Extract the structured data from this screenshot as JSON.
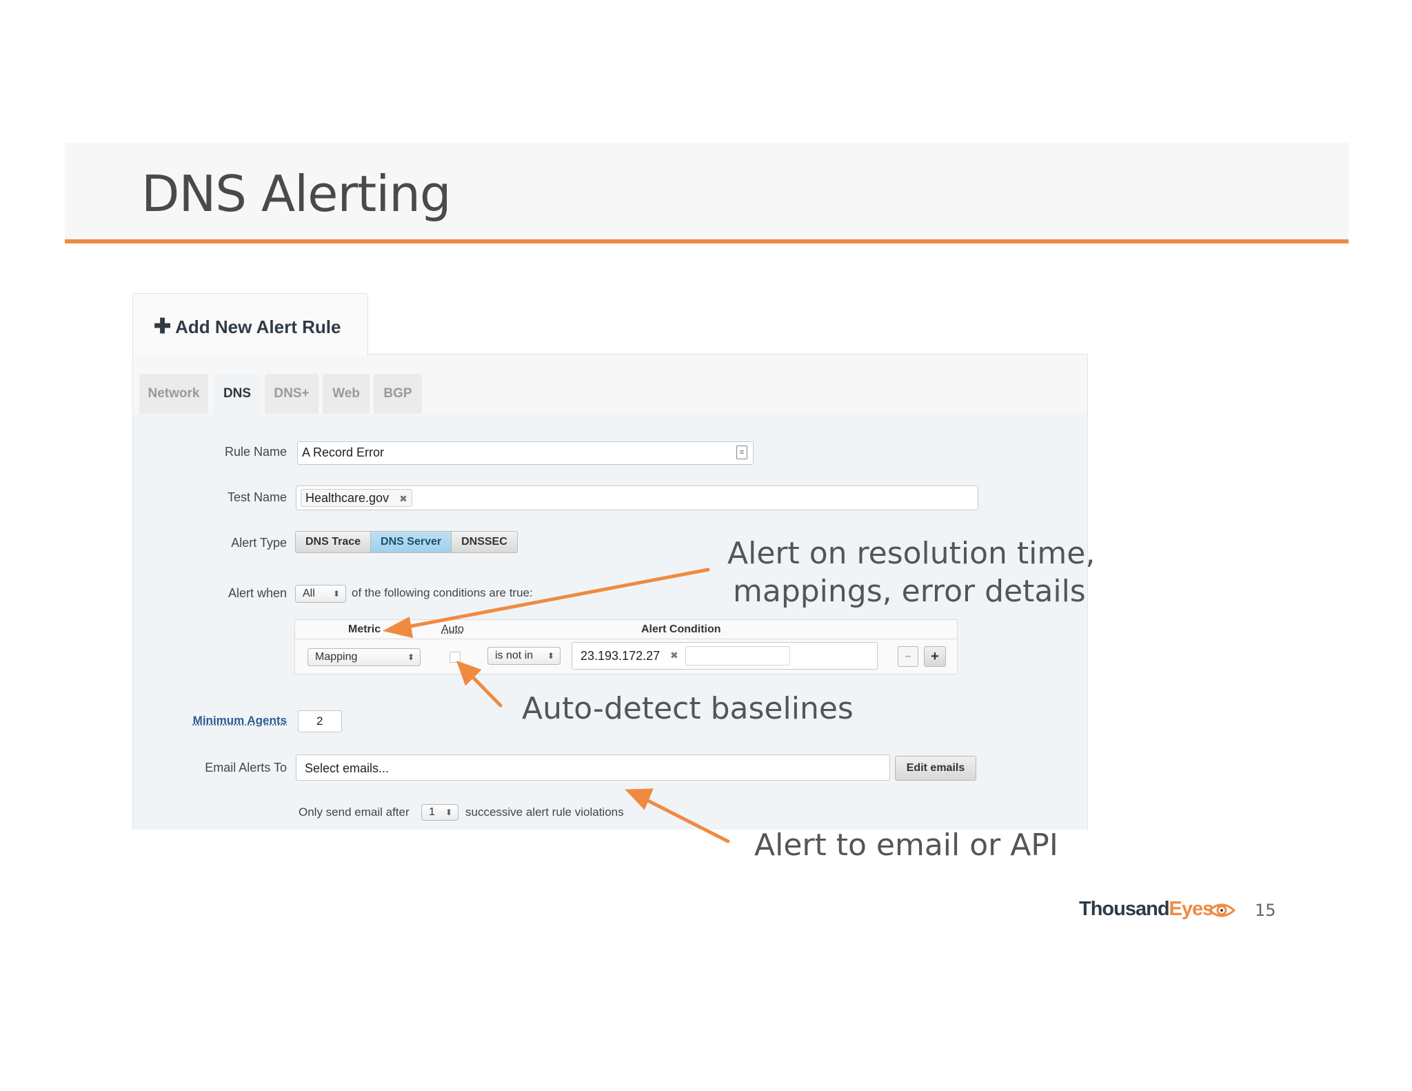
{
  "slide": {
    "title": "DNS Alerting",
    "page_number": "15"
  },
  "logo": {
    "part1": "Thousand",
    "part2": "Eyes"
  },
  "colors": {
    "accent": "#f08a40",
    "logo_dark": "#2f3b47",
    "active_tab_blue": "#9fd0ea"
  },
  "panel": {
    "header_tab": {
      "icon": "plus-icon",
      "label": "Add New Alert Rule"
    },
    "tabs": [
      {
        "label": "Network",
        "active": false
      },
      {
        "label": "DNS",
        "active": true
      },
      {
        "label": "DNS+",
        "active": false
      },
      {
        "label": "Web",
        "active": false
      },
      {
        "label": "BGP",
        "active": false
      }
    ],
    "rule_name": {
      "label": "Rule Name",
      "value": "A Record Error"
    },
    "test_name": {
      "label": "Test Name",
      "token": "Healthcare.gov"
    },
    "alert_type": {
      "label": "Alert Type",
      "options": [
        "DNS Trace",
        "DNS Server",
        "DNSSEC"
      ],
      "selected": "DNS Server"
    },
    "alert_when": {
      "label": "Alert when",
      "select_value": "All",
      "suffix": "of the following conditions are true:"
    },
    "conditions": {
      "headers": {
        "metric": "Metric",
        "auto": "Auto",
        "alert_condition": "Alert Condition"
      },
      "row": {
        "metric": "Mapping",
        "auto_checked": false,
        "operator": "is not in",
        "value_token": "23.193.172.27"
      }
    },
    "minimum_agents": {
      "label": "Minimum Agents",
      "value": "2"
    },
    "email_alerts": {
      "label": "Email Alerts To",
      "placeholder": "Select emails...",
      "edit_button": "Edit emails"
    },
    "send_after": {
      "prefix": "Only send email after",
      "value": "1",
      "suffix": "successive alert rule violations"
    }
  },
  "annotations": {
    "resolution": {
      "line1": "Alert on resolution time,",
      "line2": "mappings, error details"
    },
    "baselines": "Auto-detect baselines",
    "email": "Alert to email or API"
  }
}
